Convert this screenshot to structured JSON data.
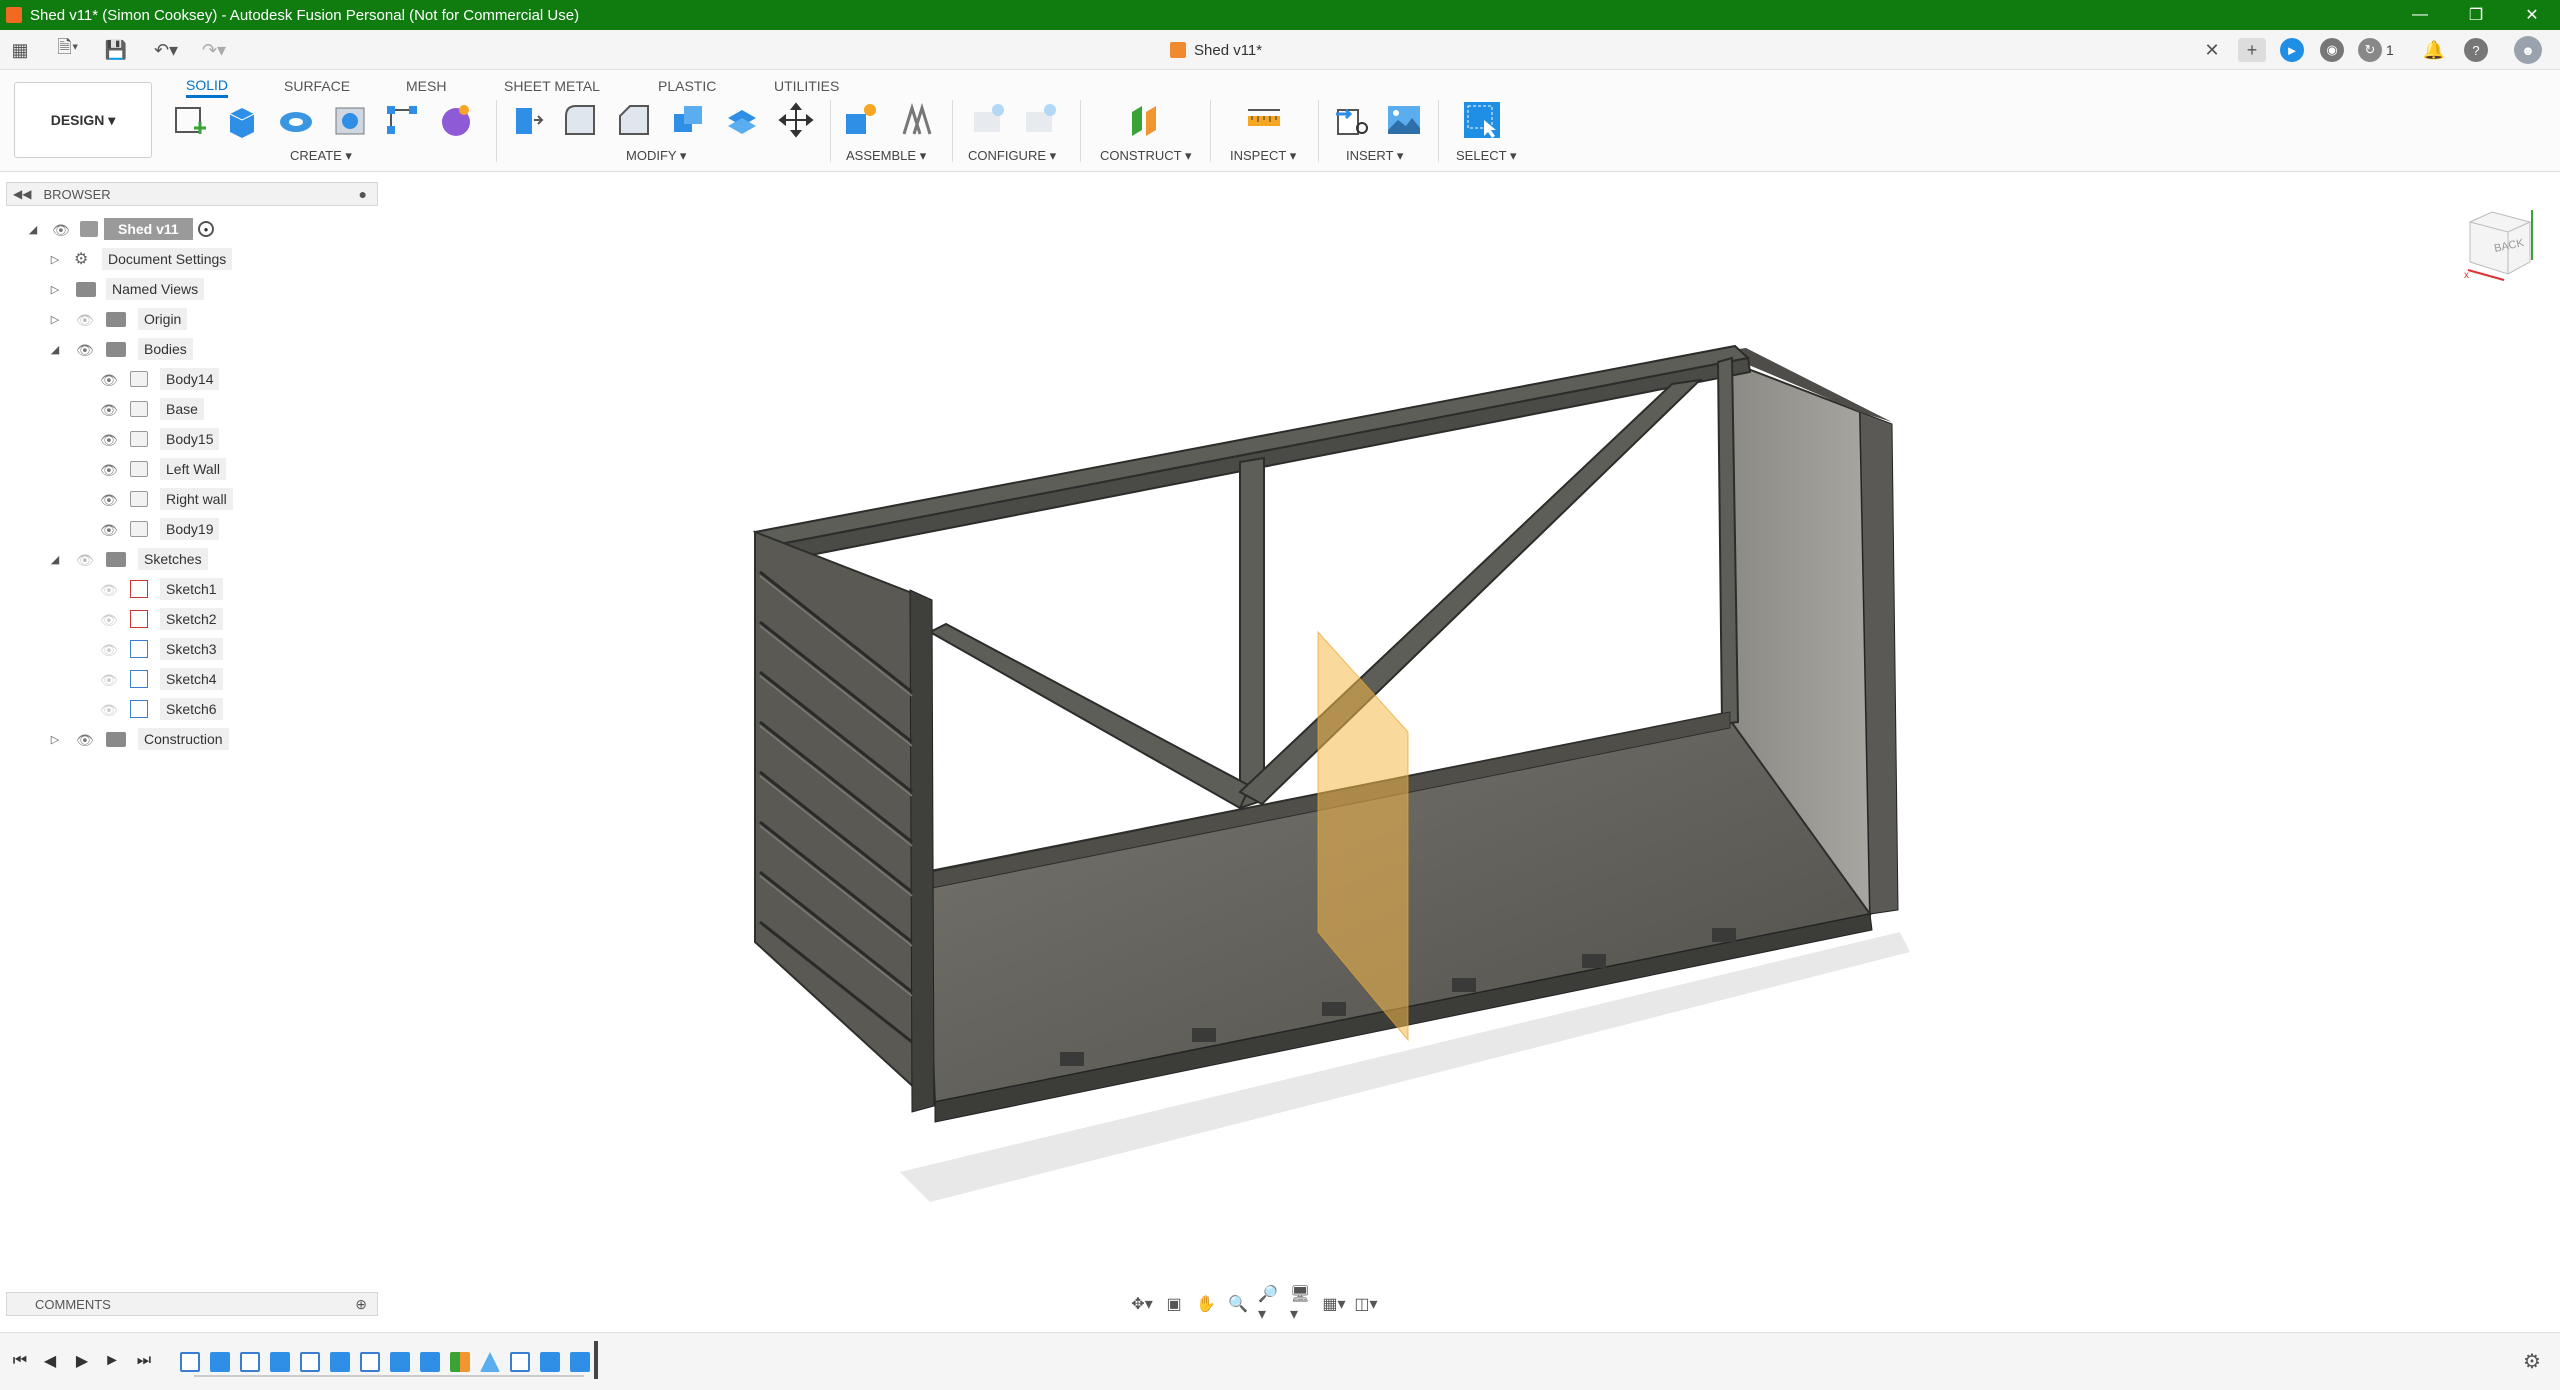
{
  "window": {
    "title": "Shed v11* (Simon Cooksey) - Autodesk Fusion Personal (Not for Commercial Use)"
  },
  "appbar": {
    "document_tab": "Shed v11*",
    "job_count": "1"
  },
  "toolbar": {
    "workspace": "DESIGN ▾",
    "tabs": [
      "SOLID",
      "SURFACE",
      "MESH",
      "SHEET METAL",
      "PLASTIC",
      "UTILITIES"
    ],
    "active_tab": "SOLID",
    "groups": {
      "create": "CREATE ▾",
      "modify": "MODIFY ▾",
      "assemble": "ASSEMBLE ▾",
      "configure": "CONFIGURE ▾",
      "construct": "CONSTRUCT ▾",
      "inspect": "INSPECT ▾",
      "insert": "INSERT ▾",
      "select": "SELECT ▾"
    }
  },
  "browser": {
    "title": "BROWSER",
    "root": "Shed v11",
    "items": {
      "document_settings": "Document Settings",
      "named_views": "Named Views",
      "origin": "Origin",
      "bodies": "Bodies",
      "constructions": "Construction",
      "sketches_folder": "Sketches"
    },
    "bodies": [
      "Body14",
      "Base",
      "Body15",
      "Left Wall",
      "Right wall",
      "Body19"
    ],
    "sketches": [
      "Sketch1",
      "Sketch2",
      "Sketch3",
      "Sketch4",
      "Sketch6"
    ]
  },
  "viewcube": {
    "face": "BACK"
  },
  "comments": {
    "title": "COMMENTS"
  },
  "colors": {
    "titlebar": "#107c10",
    "accent": "#0073cf",
    "model": "#5e5e58",
    "plane": "#f5b94a"
  }
}
